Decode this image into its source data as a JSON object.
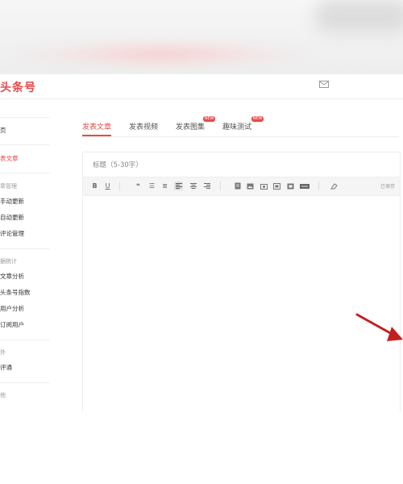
{
  "header": {
    "logo": "头条号"
  },
  "sidebar": {
    "items": [
      {
        "label": "页"
      },
      {
        "label": "表文章",
        "active": true
      },
      {
        "label": "章管理",
        "heading": true
      },
      {
        "label": "手动更新"
      },
      {
        "label": "自动更新"
      },
      {
        "label": "评论管理"
      },
      {
        "label": "据统计",
        "heading": true
      },
      {
        "label": "文章分析"
      },
      {
        "label": "头条号指数"
      },
      {
        "label": "用户分析"
      },
      {
        "label": "订阅用户"
      },
      {
        "label": "外",
        "heading": true
      },
      {
        "label": "评通"
      },
      {
        "label": "他",
        "heading": true
      }
    ]
  },
  "tabs": [
    {
      "label": "发表文章",
      "active": true
    },
    {
      "label": "发表视频"
    },
    {
      "label": "发表图集",
      "badge": "NEW"
    },
    {
      "label": "趣味测试",
      "badge": "NEW"
    }
  ],
  "editor": {
    "title_placeholder": "标题（5-30字）",
    "title_value": "",
    "autosave_text": "已保存"
  },
  "colors": {
    "accent": "#e64a4a",
    "arrow": "#c41f1f"
  }
}
